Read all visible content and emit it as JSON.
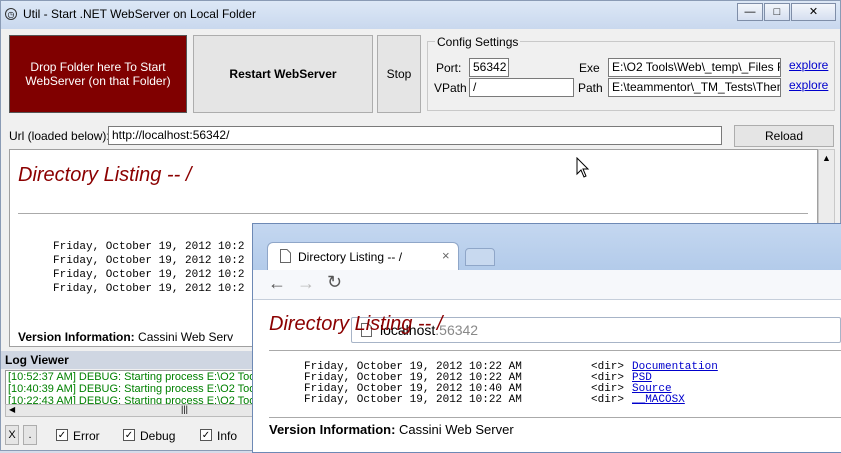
{
  "main_window": {
    "title": "Util - Start .NET WebServer on Local Folder",
    "icon": "clock-icon",
    "drop_button": "Drop Folder here To Start WebServer (on that Folder)",
    "restart_button": "Restart WebServer",
    "stop_button": "Stop",
    "config": {
      "legend": "Config Settings",
      "port_label": "Port:",
      "port_value": "56342",
      "vpath_label": "VPath",
      "vpath_value": "/",
      "exe_label": "Exe",
      "exe_value": "E:\\O2 Tools\\Web\\_temp\\_Files For",
      "path_label": "Path",
      "path_value": "E:\\teammentor\\_TM_Tests\\Theme",
      "explore_label": "explore"
    },
    "url_label": "Url (loaded below):",
    "url_value": "http://localhost:56342/",
    "reload_button": "Reload",
    "pane": {
      "title": "Directory Listing -- /",
      "rows": [
        "Friday, October 19, 2012 10:2",
        "Friday, October 19, 2012 10:2",
        "Friday, October 19, 2012 10:2",
        "Friday, October 19, 2012 10:2"
      ],
      "version_label": "Version Information:",
      "version_value": "Cassini Web Serv"
    },
    "log": {
      "title": "Log Viewer",
      "lines": [
        "[10:52:37 AM] DEBUG: Starting process E:\\O2 Tool",
        "[10:40:39 AM] DEBUG: Starting process E:\\O2 Tool",
        "[10:22:43 AM] DEBUG: Starting process E:\\O2 Tool"
      ],
      "clear_button": "X",
      "dot_button": ".",
      "error_label": "Error",
      "debug_label": "Debug",
      "info_label": "Info"
    }
  },
  "browser": {
    "tab_title": "Directory Listing -- /",
    "tab_close": "×",
    "address_host": "localhost",
    "address_port": ":56342",
    "page_title": "Directory Listing -- /",
    "entries": [
      {
        "date": "Friday, October 19, 2012 10:22 AM",
        "type": "<dir>",
        "name": "Documentation"
      },
      {
        "date": "Friday, October 19, 2012 10:22 AM",
        "type": "<dir>",
        "name": "PSD"
      },
      {
        "date": "Friday, October 19, 2012 10:40 AM",
        "type": "<dir>",
        "name": "Source"
      },
      {
        "date": "Friday, October 19, 2012 10:22 AM",
        "type": "<dir>",
        "name": "__MACOSX"
      }
    ],
    "version_label": "Version Information:",
    "version_value": "Cassini Web Server"
  },
  "colors": {
    "drop_button_bg": "#800000",
    "title_red": "#8b0000",
    "link": "#0000cc",
    "log_green": "#008000"
  }
}
